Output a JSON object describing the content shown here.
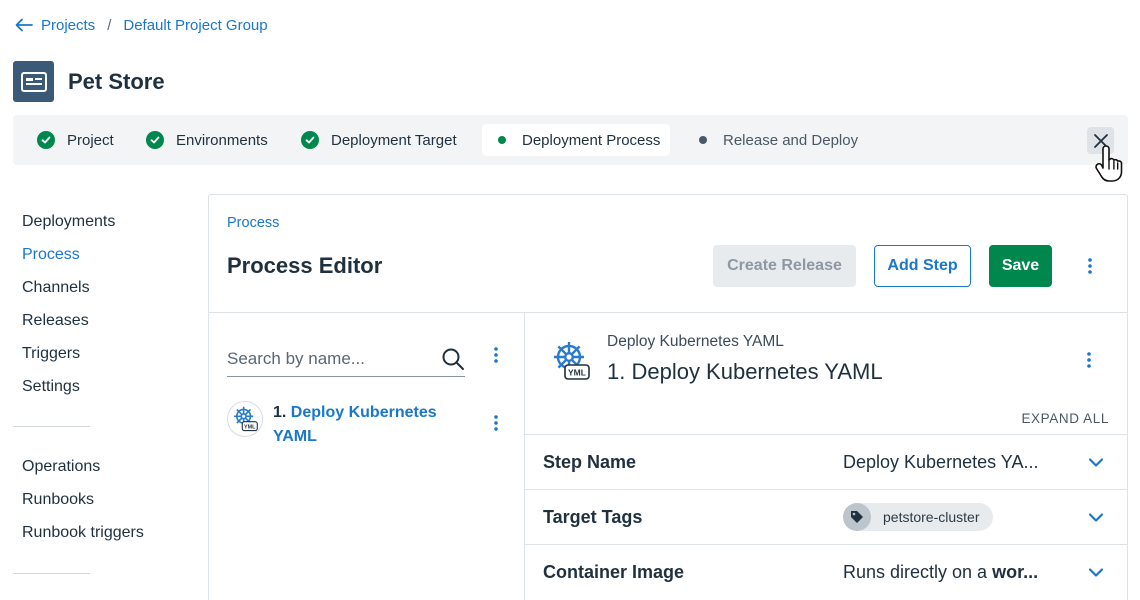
{
  "breadcrumb": {
    "projects": "Projects",
    "separator": "/",
    "group": "Default Project Group"
  },
  "header": {
    "title": "Pet Store"
  },
  "stepper": {
    "steps": [
      {
        "label": "Project",
        "state": "done"
      },
      {
        "label": "Environments",
        "state": "done"
      },
      {
        "label": "Deployment Target",
        "state": "done"
      },
      {
        "label": "Deployment Process",
        "state": "current"
      },
      {
        "label": "Release and Deploy",
        "state": "pending"
      }
    ]
  },
  "nav": {
    "group1": [
      "Deployments",
      "Process",
      "Channels",
      "Releases",
      "Triggers",
      "Settings"
    ],
    "active": "Process",
    "group2": [
      "Operations",
      "Runbooks",
      "Runbook triggers"
    ]
  },
  "editor": {
    "crumb": "Process",
    "title": "Process Editor",
    "create_release": "Create Release",
    "add_step": "Add Step",
    "save": "Save"
  },
  "steps_panel": {
    "search_placeholder": "Search by name...",
    "items": [
      {
        "number": "1.",
        "name": "Deploy Kubernetes YAML"
      }
    ]
  },
  "detail": {
    "subtitle": "Deploy Kubernetes YAML",
    "title": "1. Deploy Kubernetes YAML",
    "expand_all": "EXPAND ALL",
    "rows": [
      {
        "label": "Step Name",
        "value": "Deploy Kubernetes YA..."
      },
      {
        "label": "Target Tags",
        "value": "petstore-cluster"
      },
      {
        "label": "Container Image",
        "value_prefix": "Runs directly on a",
        "value_bold": "wor..."
      }
    ]
  },
  "colors": {
    "link": "#1a77ca",
    "success": "#00874d",
    "current_dot": "#00874d",
    "pending_dot": "#4a5866",
    "logo": "#3a5a78"
  },
  "icons": {
    "back": "arrow-left-icon",
    "logo": "project-card-icon",
    "close": "close-icon",
    "search": "search-icon",
    "kubernetes": "kubernetes-helm-icon",
    "tag": "tag-icon",
    "chevron": "chevron-down-icon",
    "more": "more-vertical-icon"
  }
}
